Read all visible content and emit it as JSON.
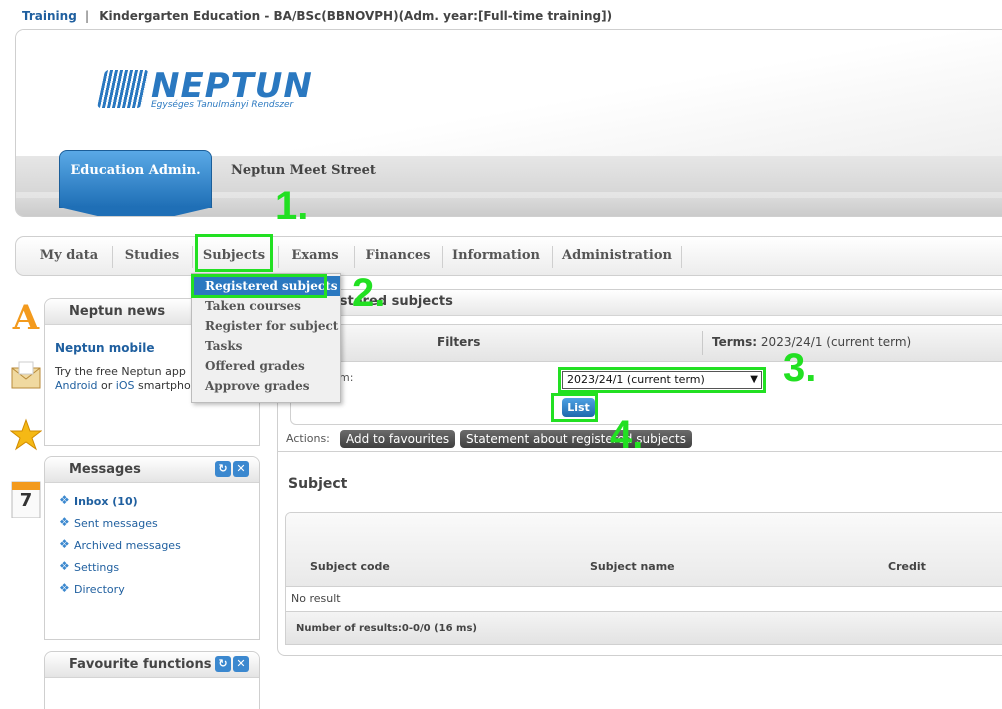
{
  "breadcrumb": {
    "training": "Training",
    "separator": "|",
    "program": "Kindergarten Education - BA/BSc(BBNOVPH)(Adm. year:[Full-time training])"
  },
  "header": {
    "logo_word": "NEPTUN",
    "logo_sub": "Egységes Tanulmányi Rendszer",
    "role": "Education Admin.",
    "meet": "Neptun Meet Street"
  },
  "nav": {
    "items": [
      "My data",
      "Studies",
      "Subjects",
      "Exams",
      "Finances",
      "Information",
      "Administration"
    ]
  },
  "dropdown": {
    "items": [
      "Registered subjects",
      "Taken courses",
      "Register for subject",
      "Tasks",
      "Offered grades",
      "Approve grades"
    ]
  },
  "annotations": [
    "1.",
    "2.",
    "3.",
    "4."
  ],
  "side_icons": {
    "a_icon": "A",
    "calendar_day": "7"
  },
  "news": {
    "title": "Neptun news",
    "headline": "Neptun mobile",
    "text_line1": "Try the free Neptun app",
    "android": "Android",
    "or": "or",
    "ios": "iOS",
    "smartphone": "smartpho"
  },
  "messages": {
    "title": "Messages",
    "items": [
      "Inbox (10)",
      "Sent messages",
      "Archived messages",
      "Settings",
      "Directory"
    ]
  },
  "favourites": {
    "title": "Favourite functions"
  },
  "main": {
    "title": "gistered subjects",
    "filters_title": "Filters",
    "terms_label": "Terms:",
    "terms_value": "2023/24/1 (current term)",
    "filter_label": "m:",
    "term_select": "2023/24/1 (current term)",
    "list_button": "List",
    "actions_label": "Actions:",
    "add_favourites": "Add to favourites",
    "statement": "Statement about registered subjects",
    "subject_section": "Subject",
    "columns": [
      "Subject code",
      "Subject name",
      "Credit"
    ],
    "no_result": "No result",
    "results": "Number of results:0-0/0 (16 ms)"
  },
  "colors": {
    "accent": "#2a78c0",
    "annotation": "#22e022"
  }
}
